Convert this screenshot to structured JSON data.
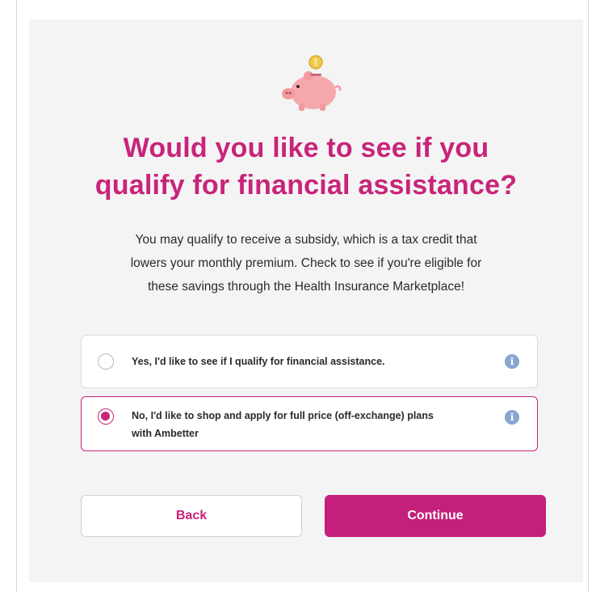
{
  "heading": {
    "lines": [
      "Would you like to see if you",
      "qualify for financial assistance?"
    ]
  },
  "description": {
    "lines": [
      "You may qualify to receive a subsidy, which is a tax credit that",
      "lowers your monthly premium.  Check to see if you're eligible for",
      "these savings through the Health Insurance Marketplace!"
    ]
  },
  "options": [
    {
      "lines": [
        "Yes, I'd like to see if I qualify for financial assistance."
      ],
      "selected": false,
      "info_icon": "info-icon"
    },
    {
      "lines": [
        "No, I'd like to shop and apply for full price (off-exchange) plans",
        "with Ambetter"
      ],
      "selected": true,
      "info_icon": "info-icon"
    }
  ],
  "info_glyph": "i",
  "buttons": {
    "back_label": "Back",
    "continue_label": "Continue"
  },
  "colors": {
    "brand": "#c8247a",
    "button_primary": "#c41f7a",
    "info": "#8aa5cf",
    "panel_bg": "#f4f4f5"
  },
  "illustration": "piggy-bank-icon"
}
